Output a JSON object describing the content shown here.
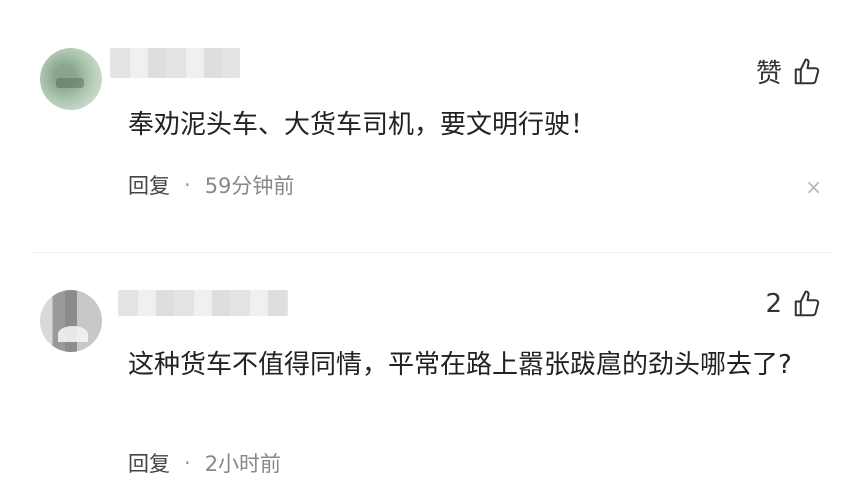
{
  "comments": [
    {
      "like_label": "赞",
      "text": "奉劝泥头车、大货车司机，要文明行驶！",
      "reply_label": "回复",
      "separator": "·",
      "time": "59分钟前",
      "close_glyph": "×"
    },
    {
      "like_count": "2",
      "text": "这种货车不值得同情，平常在路上嚣张跋扈的劲头哪去了?",
      "reply_label": "回复",
      "separator": "·",
      "time": "2小时前"
    }
  ],
  "icons": {
    "like": "thumbs-up-icon",
    "close": "close-icon"
  }
}
